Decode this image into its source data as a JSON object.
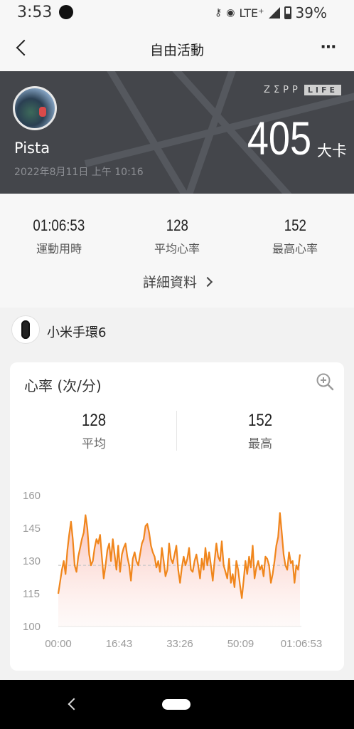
{
  "status": {
    "time": "3:53",
    "network": "LTE⁺",
    "battery": "39%"
  },
  "header": {
    "title": "自由活動"
  },
  "hero": {
    "user_name": "Pista",
    "date": "2022年8月11日 上午 10:16",
    "brand_zepp": "ZΣPP",
    "brand_life": "LIFE",
    "calories": "405",
    "calories_unit": "大卡"
  },
  "summary": {
    "stats": [
      {
        "value": "01:06:53",
        "label": "運動用時"
      },
      {
        "value": "128",
        "label": "平均心率"
      },
      {
        "value": "152",
        "label": "最高心率"
      }
    ],
    "details_link": "詳細資料"
  },
  "device": {
    "name": "小米手環6"
  },
  "heart_card": {
    "title": "心率 (次/分)",
    "average": {
      "value": "128",
      "label": "平均"
    },
    "max": {
      "value": "152",
      "label": "最高"
    }
  },
  "colors": {
    "line": "#f0861c",
    "hero_bg": "#44464b",
    "average_line": "#c8c8c8"
  },
  "chart_data": {
    "type": "area",
    "ylim": [
      100,
      160
    ],
    "y_ticks": [
      "160",
      "145",
      "130",
      "115",
      "100"
    ],
    "x_ticks": [
      "00:00",
      "16:43",
      "33:26",
      "50:09",
      "01:06:53"
    ],
    "average": 128,
    "xlim_minutes": [
      0,
      66.9
    ],
    "x": [
      0,
      1,
      1.5,
      2,
      2.5,
      3,
      3.5,
      4,
      4.5,
      5,
      5.5,
      6,
      6.5,
      7,
      7.5,
      8,
      8.5,
      9,
      9.5,
      10,
      10.5,
      11,
      11.5,
      12,
      12.5,
      13,
      13.5,
      14,
      14.5,
      15,
      15.5,
      16,
      16.5,
      17,
      17.5,
      18,
      18.5,
      19,
      19.5,
      20,
      20.5,
      21,
      21.5,
      22,
      22.5,
      23,
      23.5,
      24,
      24.5,
      25,
      25.5,
      26,
      26.5,
      27,
      27.5,
      28,
      28.5,
      29,
      29.5,
      30,
      30.5,
      31,
      31.5,
      32,
      32.5,
      33,
      33.5,
      34,
      34.5,
      35,
      35.5,
      36,
      36.5,
      37,
      37.5,
      38,
      38.5,
      39,
      39.5,
      40,
      40.5,
      41,
      41.5,
      42,
      42.5,
      43,
      43.5,
      44,
      44.5,
      45,
      45.5,
      46,
      46.5,
      47,
      47.5,
      48,
      48.5,
      49,
      49.5,
      50,
      50.5,
      51,
      51.5,
      52,
      52.5,
      53,
      53.5,
      54,
      54.5,
      55,
      55.5,
      56,
      56.5,
      57,
      57.5,
      58,
      58.5,
      59,
      59.5,
      60,
      60.5,
      61,
      61.5,
      62,
      62.5,
      63,
      63.5,
      64,
      64.5,
      65,
      65.5,
      66,
      66.5
    ],
    "values": [
      115,
      126,
      130,
      124,
      135,
      142,
      148,
      140,
      128,
      125,
      132,
      136,
      140,
      143,
      151,
      145,
      133,
      128,
      130,
      136,
      140,
      138,
      142,
      132,
      122,
      128,
      135,
      138,
      130,
      140,
      133,
      126,
      137,
      125,
      133,
      136,
      138,
      132,
      128,
      121,
      131,
      134,
      130,
      128,
      133,
      138,
      140,
      146,
      147,
      143,
      137,
      134,
      132,
      127,
      130,
      125,
      136,
      130,
      123,
      126,
      138,
      131,
      129,
      133,
      137,
      126,
      120,
      127,
      132,
      128,
      131,
      136,
      126,
      125,
      130,
      133,
      128,
      122,
      131,
      126,
      136,
      128,
      134,
      128,
      121,
      130,
      138,
      132,
      130,
      139,
      128,
      125,
      122,
      131,
      120,
      124,
      118,
      130,
      126,
      119,
      113,
      121,
      130,
      124,
      132,
      127,
      137,
      122,
      127,
      130,
      126,
      128,
      123,
      132,
      131,
      128,
      120,
      124,
      130,
      137,
      141,
      152,
      143,
      133,
      128,
      126,
      134,
      129,
      130,
      120,
      128,
      126,
      133,
      127,
      121
    ]
  }
}
